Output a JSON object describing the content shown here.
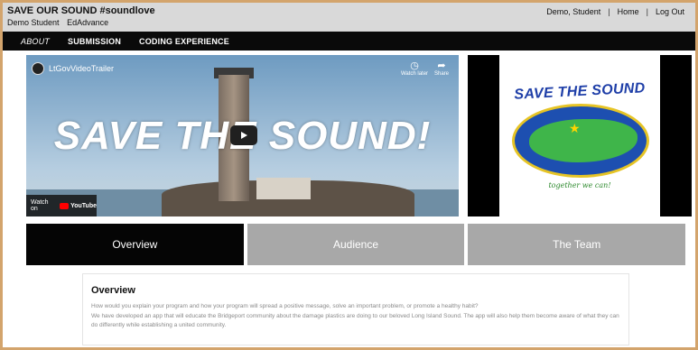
{
  "site": {
    "title": "SAVE OUR SOUND #soundlove",
    "user_name": "Demo Student",
    "org": "EdAdvance"
  },
  "top_links": {
    "user": "Demo, Student",
    "home": "Home",
    "logout": "Log Out",
    "separator": "|"
  },
  "nav": {
    "items": [
      {
        "label": "ABOUT",
        "active": true
      },
      {
        "label": "SUBMISSION",
        "active": false
      },
      {
        "label": "CODING EXPERIENCE",
        "active": false
      }
    ]
  },
  "video": {
    "channel": "LtGovVideoTrailer",
    "headline": "SAVE THE SOUND!",
    "watch_later": "Watch later",
    "share": "Share",
    "watch_on": "Watch on",
    "youtube": "YouTube"
  },
  "logo": {
    "title": "SAVE THE SOUND",
    "tagline": "together we can!"
  },
  "tabs": [
    {
      "label": "Overview",
      "active": true
    },
    {
      "label": "Audience",
      "active": false
    },
    {
      "label": "The Team",
      "active": false
    }
  ],
  "overview": {
    "title": "Overview",
    "question": "How would you explain your program and how your program will spread a positive message, solve an important problem, or promote a healthy habit?",
    "answer": "We have developed an app that will educate the Bridgeport community about the damage plastics are doing to our beloved Long Island Sound. The app will also help them become aware of what they can do differently while establishing a united community."
  },
  "colors": {
    "frame": "#d3a46c",
    "nav_bg": "#0a0a0a",
    "tab_active": "#050505",
    "tab_inactive": "#a8a8a8",
    "logo_blue": "#1f3fa8",
    "logo_green": "#3fb54a"
  }
}
